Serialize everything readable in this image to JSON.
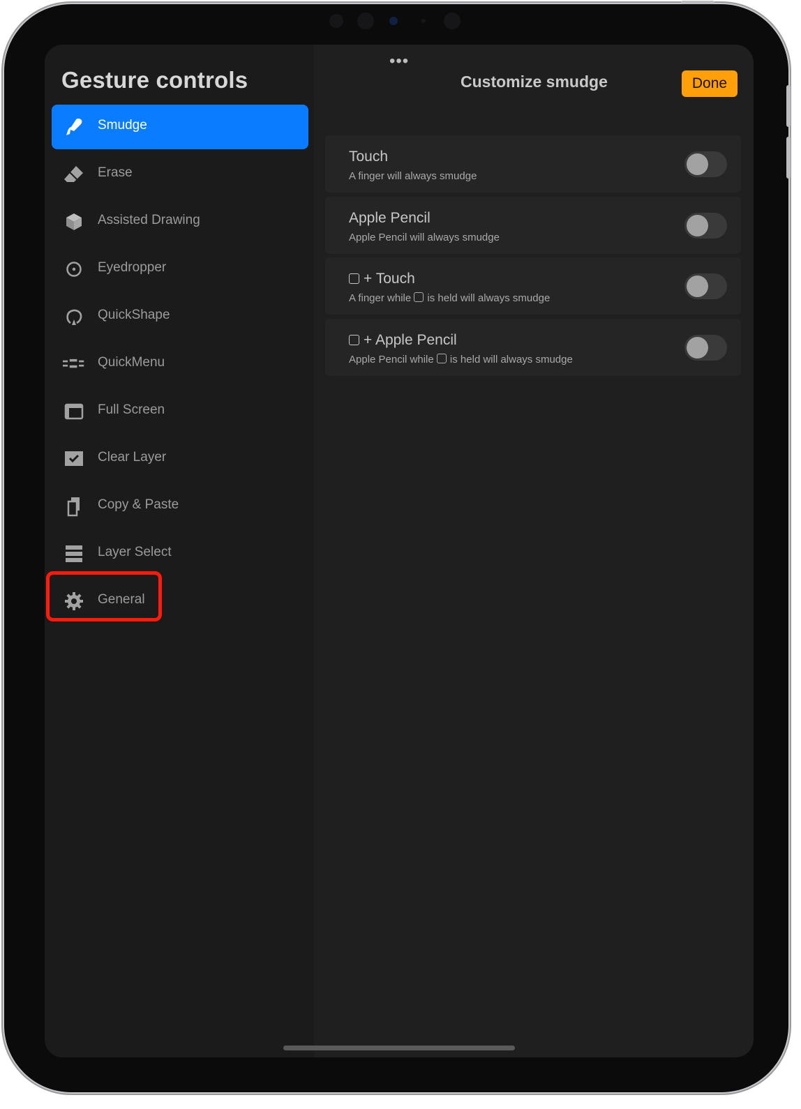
{
  "sidebar": {
    "title": "Gesture controls",
    "items": [
      {
        "label": "Smudge",
        "icon": "smudge-icon",
        "active": true
      },
      {
        "label": "Erase",
        "icon": "eraser-icon",
        "active": false
      },
      {
        "label": "Assisted Drawing",
        "icon": "cube-icon",
        "active": false
      },
      {
        "label": "Eyedropper",
        "icon": "eyedropper-icon",
        "active": false
      },
      {
        "label": "QuickShape",
        "icon": "quickshape-icon",
        "active": false
      },
      {
        "label": "QuickMenu",
        "icon": "quickmenu-icon",
        "active": false
      },
      {
        "label": "Full Screen",
        "icon": "full-screen-icon",
        "active": false
      },
      {
        "label": "Clear Layer",
        "icon": "clear-layer-icon",
        "active": false
      },
      {
        "label": "Copy & Paste",
        "icon": "copy-paste-icon",
        "active": false
      },
      {
        "label": "Layer Select",
        "icon": "layers-icon",
        "active": false
      },
      {
        "label": "General",
        "icon": "gear-icon",
        "active": false,
        "highlighted": true
      }
    ]
  },
  "main": {
    "grabber": "•••",
    "title": "Customize smudge",
    "done_label": "Done",
    "options": [
      {
        "title": "Touch",
        "subtitle": "A finger will always smudge",
        "enabled": false
      },
      {
        "title": "Apple Pencil",
        "subtitle": "Apple Pencil will always smudge",
        "enabled": false
      },
      {
        "title_suffix": "+ Touch",
        "subtitle_prefix": "A finger while",
        "subtitle_suffix": "is held will always smudge",
        "enabled": false
      },
      {
        "title_suffix": "+ Apple Pencil",
        "subtitle_prefix": "Apple Pencil while",
        "subtitle_suffix": "is held will always smudge",
        "enabled": false
      }
    ]
  },
  "colors": {
    "accent_blue": "#0a7cff",
    "done_orange": "#ff9f0a",
    "highlight_red": "#ff1b0b"
  }
}
